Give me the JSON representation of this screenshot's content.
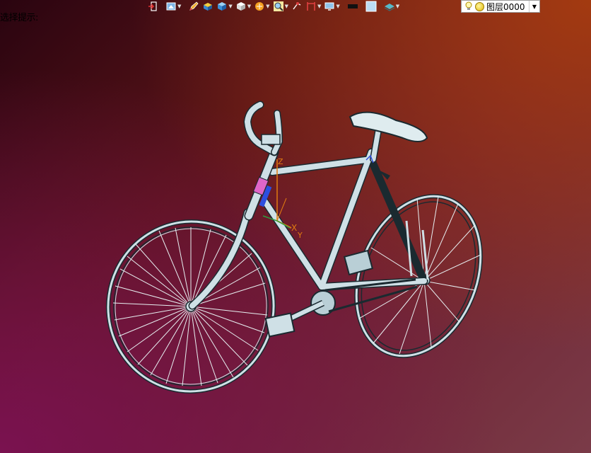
{
  "hint_text": "选择提示:",
  "toolbar": {
    "buttons": [
      {
        "icon": "exit-icon",
        "has_dropdown": false
      },
      {
        "icon": "view-orient-icon",
        "has_dropdown": true
      },
      {
        "icon": "pencil-icon",
        "has_dropdown": false
      },
      {
        "icon": "shaded-box-icon",
        "has_dropdown": false
      },
      {
        "icon": "blue-cube-icon",
        "has_dropdown": true
      },
      {
        "icon": "white-cube-icon",
        "has_dropdown": true
      },
      {
        "icon": "render-style-icon",
        "has_dropdown": true
      },
      {
        "icon": "zoom-icon",
        "has_dropdown": true
      },
      {
        "icon": "snap-icon",
        "has_dropdown": false
      },
      {
        "icon": "section-icon",
        "has_dropdown": true
      },
      {
        "icon": "display-icon",
        "has_dropdown": true
      },
      {
        "icon": "black-rect-icon",
        "has_dropdown": false
      },
      {
        "icon": "plane-icon",
        "has_dropdown": false
      },
      {
        "icon": "layers-icon",
        "has_dropdown": true
      }
    ]
  },
  "layer_selector": {
    "value": "图层0000"
  },
  "axis": {
    "x_label": "X",
    "y_label": "Y",
    "z_label": "Z"
  },
  "colors": {
    "frame": "#cfe0e6",
    "frame_outline": "#1a2a30",
    "highlight_magenta": "#e066c8",
    "highlight_blue": "#2d4fe0",
    "axis_orange": "#e07a10"
  }
}
